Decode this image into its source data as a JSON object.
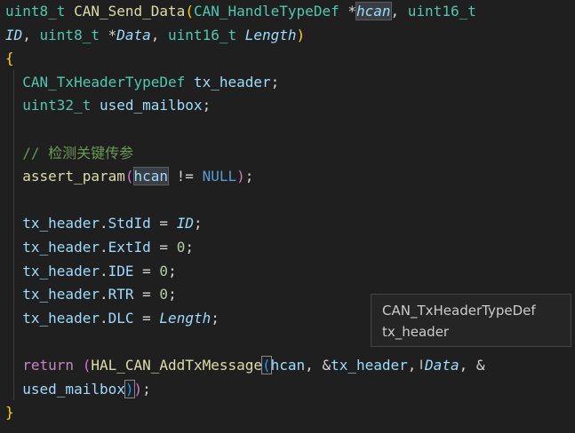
{
  "code": {
    "l1": {
      "ret_type": "uint8_t",
      "func": "CAN_Send_Data",
      "open": "(",
      "ptype": "CAN_HandleTypeDef",
      "star": " *",
      "pname": "hcan",
      "comma": ", ",
      "type2": "uint16_t"
    },
    "l2": {
      "pname": "ID",
      "comma1": ", ",
      "type": "uint8_t",
      "star": " *",
      "pname2": "Data",
      "comma2": ", ",
      "type2": "uint16_t",
      "pname3": " Length",
      "close": ")"
    },
    "l3": {
      "brace": "{"
    },
    "l4": {
      "type": "CAN_TxHeaderTypeDef",
      "var": " tx_header",
      "semi": ";"
    },
    "l5": {
      "type": "uint32_t",
      "var": " used_mailbox",
      "semi": ";"
    },
    "l7": {
      "comment": "// 检测关键传参"
    },
    "l8": {
      "func": "assert_param",
      "open": "(",
      "var": "hcan",
      "op": " != ",
      "null": "NULL",
      "close": ")",
      "semi": ";"
    },
    "l10": {
      "obj": "tx_header",
      "dot": ".",
      "field": "StdId",
      "eq": " = ",
      "val": "ID",
      "semi": ";"
    },
    "l11": {
      "obj": "tx_header",
      "dot": ".",
      "field": "ExtId",
      "eq": " = ",
      "val": "0",
      "semi": ";"
    },
    "l12": {
      "obj": "tx_header",
      "dot": ".",
      "field": "IDE",
      "eq": " = ",
      "val": "0",
      "semi": ";"
    },
    "l13": {
      "obj": "tx_header",
      "dot": ".",
      "field": "RTR",
      "eq": " = ",
      "val": "0",
      "semi": ";"
    },
    "l14": {
      "obj": "tx_header",
      "dot": ".",
      "field": "DLC",
      "eq": " = ",
      "val": "Length",
      "semi": ";"
    },
    "l16": {
      "kw": "return",
      "sp": " ",
      "open1": "(",
      "func": "HAL_CAN_AddTxMessage",
      "open2": "(",
      "a1": "hcan",
      "c1": ", &",
      "a2": "tx_header",
      "c2": ", ",
      "a3": "Data",
      "c3": ", &"
    },
    "l17": {
      "a4": "used_mailbox",
      "close2": ")",
      "close1": ")",
      "semi": ";"
    },
    "l18": {
      "brace": "}"
    }
  },
  "tooltip": {
    "type": "CAN_TxHeaderTypeDef",
    "name": "tx_header"
  },
  "cursor_glyph": "I"
}
